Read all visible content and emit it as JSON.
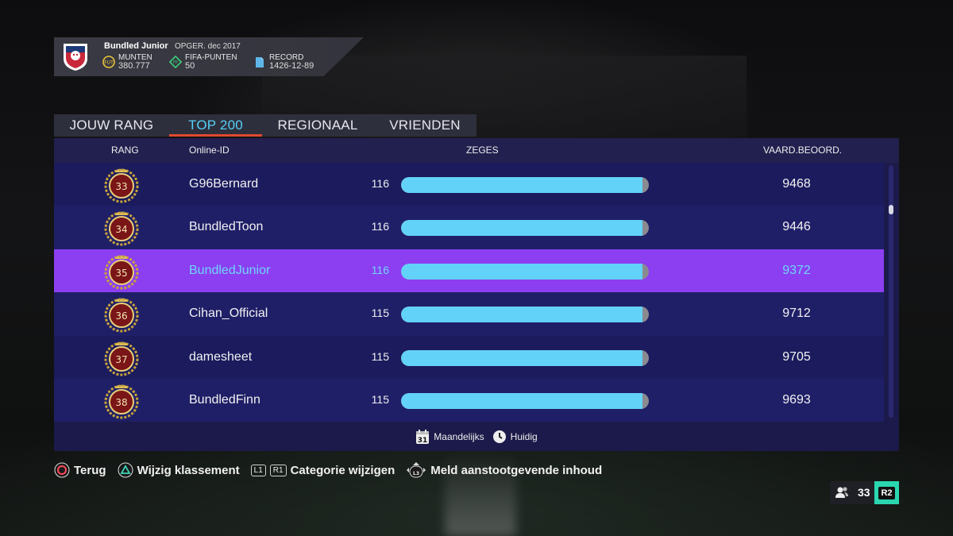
{
  "profile": {
    "name": "Bundled Junior",
    "joined": "OPGER. dec 2017",
    "coins": {
      "label": "MUNTEN",
      "value": "380.777"
    },
    "fifa_points": {
      "label": "FIFA-PUNTEN",
      "value": "50"
    },
    "record": {
      "label": "RECORD",
      "value": "1426-12-89"
    }
  },
  "tabs": [
    {
      "label": "JOUW RANG",
      "active": false
    },
    {
      "label": "TOP 200",
      "active": true
    },
    {
      "label": "REGIONAAL",
      "active": false
    },
    {
      "label": "VRIENDEN",
      "active": false
    }
  ],
  "table": {
    "headers": {
      "rank": "RANG",
      "online_id": "Online-ID",
      "wins": "ZEGES",
      "rating": "VAARD.BEOORD."
    },
    "rows": [
      {
        "rank": "33",
        "id": "G96Bernard",
        "wins": "116",
        "rating": "9468",
        "selected": false
      },
      {
        "rank": "34",
        "id": "BundledToon",
        "wins": "116",
        "rating": "9446",
        "selected": false
      },
      {
        "rank": "35",
        "id": "BundledJunior",
        "wins": "116",
        "rating": "9372",
        "selected": true
      },
      {
        "rank": "36",
        "id": "Cihan_Official",
        "wins": "115",
        "rating": "9712",
        "selected": false
      },
      {
        "rank": "37",
        "id": "damesheet",
        "wins": "115",
        "rating": "9705",
        "selected": false
      },
      {
        "rank": "38",
        "id": "BundledFinn",
        "wins": "115",
        "rating": "9693",
        "selected": false
      }
    ],
    "wins_bar_fill": 0.975
  },
  "footer": {
    "calendar_day": "31",
    "monthly": "Maandelijks",
    "current": "Huidig"
  },
  "controls": {
    "back": "Terug",
    "change_ranking": "Wijzig klassement",
    "l1": "L1",
    "r1": "R1",
    "change_category": "Categorie wijzigen",
    "l3": "L3",
    "report": "Meld aanstootgevende inhoud"
  },
  "friends": {
    "count": "33",
    "button": "R2"
  },
  "colors": {
    "accent": "#55d0f5",
    "selection": "#8b3ff0",
    "tab_underline": "#e04a2f",
    "bar_fill": "#63d2f8",
    "r2_button": "#2ad6b0"
  }
}
